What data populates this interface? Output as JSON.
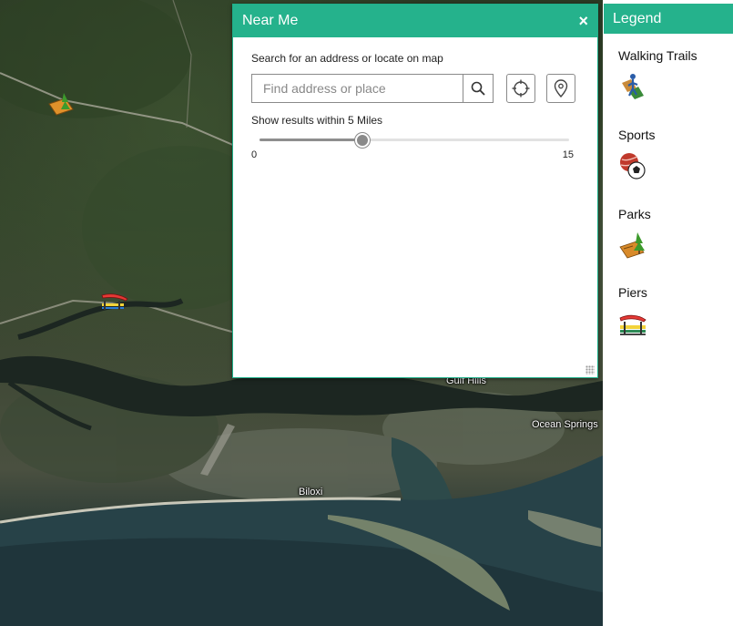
{
  "map": {
    "labels": [
      {
        "text": "Gulf Hills",
        "pos": "gulf"
      },
      {
        "text": "Ocean Springs",
        "pos": "ocean"
      },
      {
        "text": "Biloxi",
        "pos": "biloxi"
      }
    ],
    "markers": [
      {
        "name": "park-marker-icon",
        "glyph": "🌲"
      },
      {
        "name": "pier-marker-icon",
        "glyph": "🛶"
      }
    ]
  },
  "near_me": {
    "title": "Near Me",
    "close_symbol": "×",
    "search_caption": "Search for an address or locate on map",
    "search_placeholder": "Find address or place",
    "radius_caption": "Show results within 5 Miles",
    "slider": {
      "min_label": "0",
      "max_label": "15",
      "min": 0,
      "max": 15,
      "value": 5
    }
  },
  "legend": {
    "title": "Legend",
    "items": [
      {
        "label": "Walking Trails",
        "icon": "walking-trails-icon"
      },
      {
        "label": "Sports",
        "icon": "sports-icon"
      },
      {
        "label": "Parks",
        "icon": "parks-icon"
      },
      {
        "label": "Piers",
        "icon": "piers-icon"
      }
    ]
  },
  "colors": {
    "accent": "#25b28c",
    "panel_border": "#1fb08a"
  }
}
